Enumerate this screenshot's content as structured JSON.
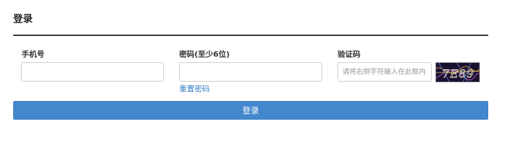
{
  "header": {
    "title": "登录"
  },
  "form": {
    "phone": {
      "label": "手机号",
      "value": "",
      "placeholder": ""
    },
    "password": {
      "label": "密码(至少6位)",
      "value": "",
      "placeholder": ""
    },
    "reset_link": "重置密码",
    "captcha": {
      "label": "验证码",
      "value": "",
      "placeholder": "请将右侧字符输入在此框内",
      "code": "7E89"
    },
    "submit_label": "登录"
  },
  "colors": {
    "accent": "#4387cd",
    "link": "#3a7fc8",
    "divider": "#333333"
  }
}
